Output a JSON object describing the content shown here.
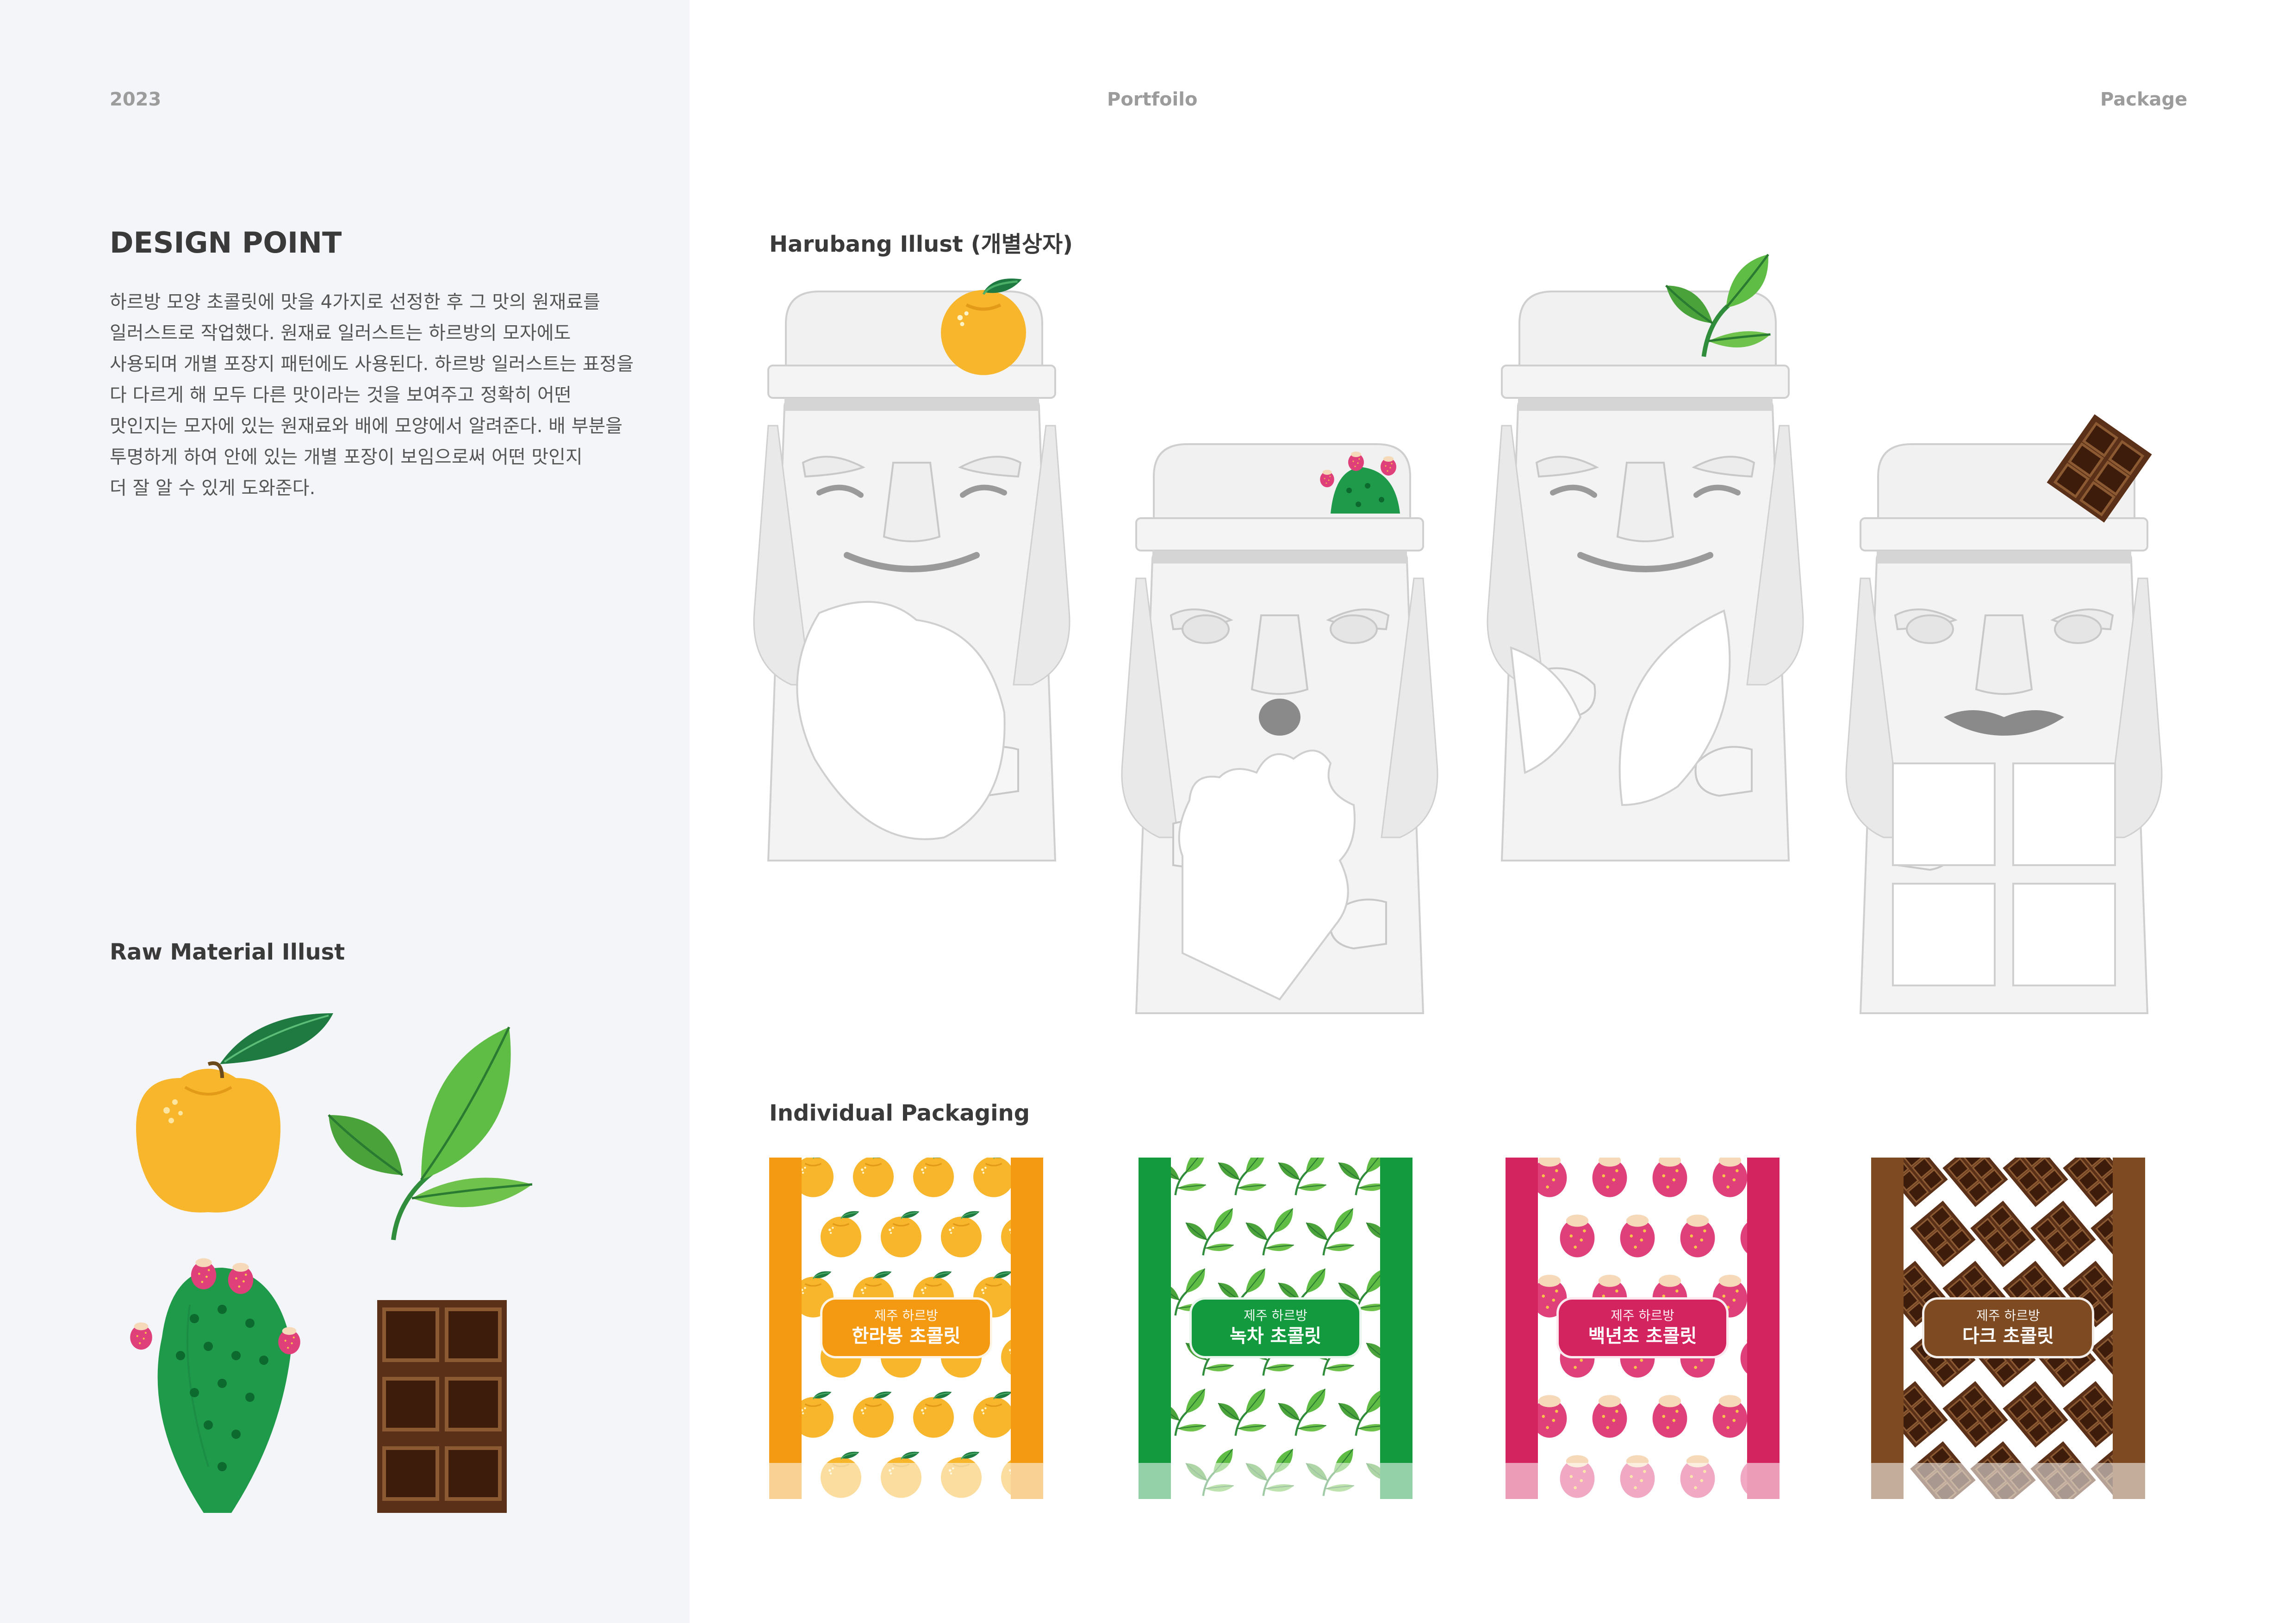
{
  "header": {
    "year": "2023",
    "center": "Portfoilo",
    "right": "Package"
  },
  "design_point": {
    "title": "DESIGN POINT",
    "lines": [
      "하르방 모양 초콜릿에 맛을 4가지로 선정한 후 그 맛의 원재료를",
      "일러스트로 작업했다. 원재료 일러스트는 하르방의 모자에도",
      "사용되며 개별 포장지 패턴에도 사용된다. 하르방 일러스트는 표정을",
      "다 다르게 해 모두 다른 맛이라는 것을 보여주고 정확히 어떤",
      "맛인지는 모자에 있는 원재료와 배에 모양에서 알려준다. 배 부분을",
      "투명하게 하여 안에 있는 개별 포장이 보임으로써 어떤 맛인지",
      "더 잘 알 수 있게 도와준다."
    ]
  },
  "raw_material": {
    "title": "Raw Material Illust"
  },
  "harubang": {
    "title": "Harubang Illust (개별상자)"
  },
  "packaging": {
    "title": "Individual Packaging",
    "items": [
      {
        "sub": "제주 하르방",
        "name": "한라봉 초콜릿",
        "color": "#f39a12",
        "bg": "#ffffff"
      },
      {
        "sub": "제주 하르방",
        "name": "녹차 초콜릿",
        "color": "#149a3e",
        "bg": "#ffffff"
      },
      {
        "sub": "제주 하르방",
        "name": "백년초 초콜릿",
        "color": "#d4245f",
        "bg": "#ffffff"
      },
      {
        "sub": "제주 하르방",
        "name": "다크 초콜릿",
        "color": "#7d4a22",
        "bg": "#ffffff"
      }
    ]
  }
}
